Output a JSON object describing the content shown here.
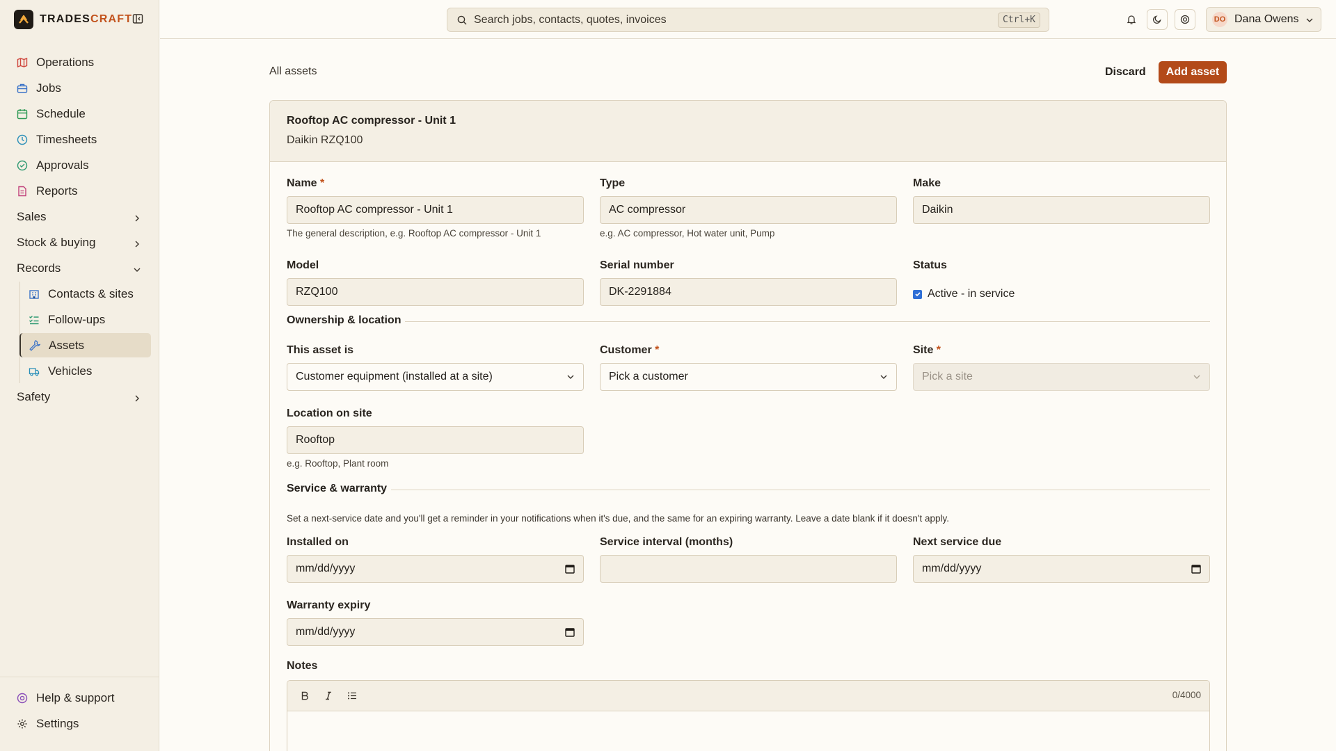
{
  "brand": {
    "name_main": "TRADES",
    "name_accent": "CRAFT"
  },
  "search": {
    "placeholder": "Search jobs, contacts, quotes, invoices",
    "shortcut": "Ctrl+K"
  },
  "user": {
    "initials": "DO",
    "name": "Dana Owens"
  },
  "sidebar": {
    "items": [
      {
        "label": "Operations",
        "icon": "map-icon",
        "color": "#d0483f"
      },
      {
        "label": "Jobs",
        "icon": "briefcase-icon",
        "color": "#3b73c8"
      },
      {
        "label": "Schedule",
        "icon": "calendar-icon",
        "color": "#2f9a55"
      },
      {
        "label": "Timesheets",
        "icon": "clock-icon",
        "color": "#2a8fb8"
      },
      {
        "label": "Approvals",
        "icon": "check-circle-icon",
        "color": "#2f9a72"
      },
      {
        "label": "Reports",
        "icon": "document-icon",
        "color": "#c0407a"
      }
    ],
    "groups": {
      "sales": "Sales",
      "stock": "Stock & buying",
      "records": "Records",
      "safety": "Safety"
    },
    "records_items": [
      {
        "label": "Contacts & sites",
        "icon": "building-icon"
      },
      {
        "label": "Follow-ups",
        "icon": "list-check-icon"
      },
      {
        "label": "Assets",
        "icon": "wrench-icon"
      },
      {
        "label": "Vehicles",
        "icon": "truck-icon"
      }
    ],
    "bottom": {
      "help": "Help & support",
      "settings": "Settings"
    }
  },
  "page": {
    "breadcrumb": "All assets",
    "discard": "Discard",
    "add": "Add asset",
    "card_title": "Rooftop AC compressor - Unit 1",
    "card_subtitle": "Daikin RZQ100"
  },
  "form": {
    "name": {
      "label": "Name",
      "value": "Rooftop AC compressor - Unit 1",
      "hint": "The general description, e.g. Rooftop AC compressor - Unit 1"
    },
    "type": {
      "label": "Type",
      "value": "AC compressor",
      "hint": "e.g. AC compressor, Hot water unit, Pump"
    },
    "make": {
      "label": "Make",
      "value": "Daikin"
    },
    "model": {
      "label": "Model",
      "value": "RZQ100"
    },
    "serial": {
      "label": "Serial number",
      "value": "DK-2291884"
    },
    "status": {
      "label": "Status",
      "checkbox_label": "Active - in service",
      "checked": true
    },
    "ownership_title": "Ownership & location",
    "asset_is": {
      "label": "This asset is",
      "value": "Customer equipment (installed at a site)"
    },
    "customer": {
      "label": "Customer",
      "value": "Pick a customer"
    },
    "site": {
      "label": "Site",
      "value": "Pick a site"
    },
    "location": {
      "label": "Location on site",
      "value": "Rooftop",
      "hint": "e.g. Rooftop, Plant room"
    },
    "service_title": "Service & warranty",
    "service_desc": "Set a next-service date and you'll get a reminder in your notifications when it's due, and the same for an expiring warranty. Leave a date blank if it doesn't apply.",
    "installed": {
      "label": "Installed on",
      "value": "mm/dd/yyyy"
    },
    "interval": {
      "label": "Service interval (months)",
      "value": ""
    },
    "next_service": {
      "label": "Next service due",
      "value": "mm/dd/yyyy"
    },
    "warranty": {
      "label": "Warranty expiry",
      "value": "mm/dd/yyyy"
    },
    "notes": {
      "label": "Notes",
      "counter": "0/4000"
    }
  },
  "colors": {
    "accent": "#b34a19",
    "required": "#c2531d",
    "checkbox": "#2f6fd6"
  }
}
